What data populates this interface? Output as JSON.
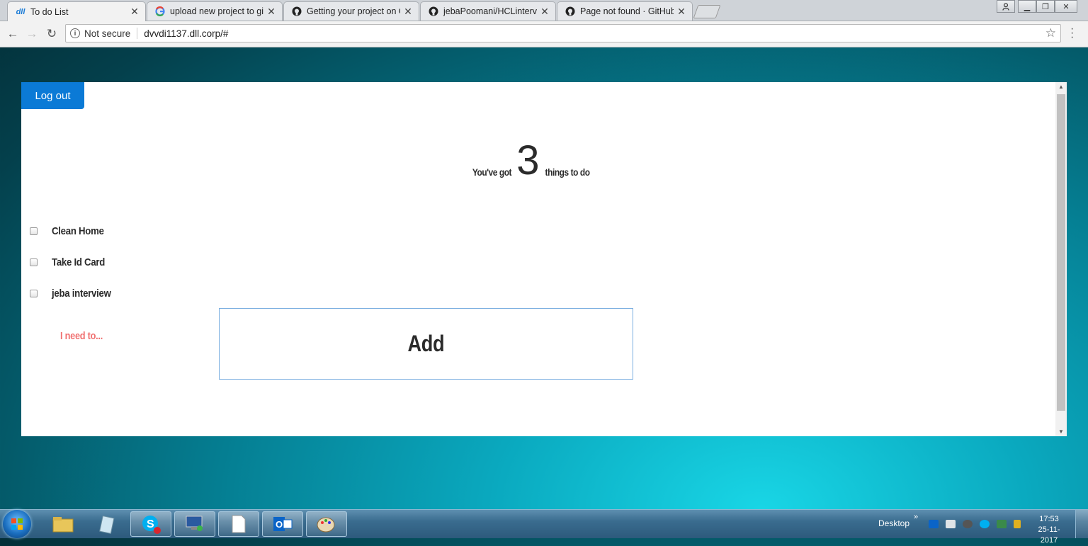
{
  "browser": {
    "tabs": [
      {
        "title": "To do List",
        "icon": "dll-logo-icon",
        "active": true
      },
      {
        "title": "upload new project to gi",
        "icon": "google-icon",
        "active": false
      },
      {
        "title": "Getting your project on G",
        "icon": "github-icon",
        "active": false
      },
      {
        "title": "jebaPoomani/HCLintervie",
        "icon": "github-icon",
        "active": false
      },
      {
        "title": "Page not found · GitHub",
        "icon": "github-icon",
        "active": false
      }
    ],
    "security_label": "Not secure",
    "url": "dvvdi1137.dll.corp/#",
    "favicon_text": "dll"
  },
  "page": {
    "logout_label": "Log out",
    "heading_prefix": "You've got",
    "count": "3",
    "heading_suffix": "things to do",
    "todos": [
      {
        "label": "Clean Home",
        "checked": false
      },
      {
        "label": "Take Id Card",
        "checked": false
      },
      {
        "label": "jeba interview",
        "checked": false
      }
    ],
    "input_placeholder": "I need to...",
    "add_label": "Add"
  },
  "taskbar": {
    "desktop_label": "Desktop",
    "chevron": "»",
    "time": "17:53",
    "date": "25-11-2017"
  },
  "colors": {
    "logout_bg": "#0b7ad6",
    "placeholder": "#f07070",
    "add_border": "#7aaee0"
  }
}
